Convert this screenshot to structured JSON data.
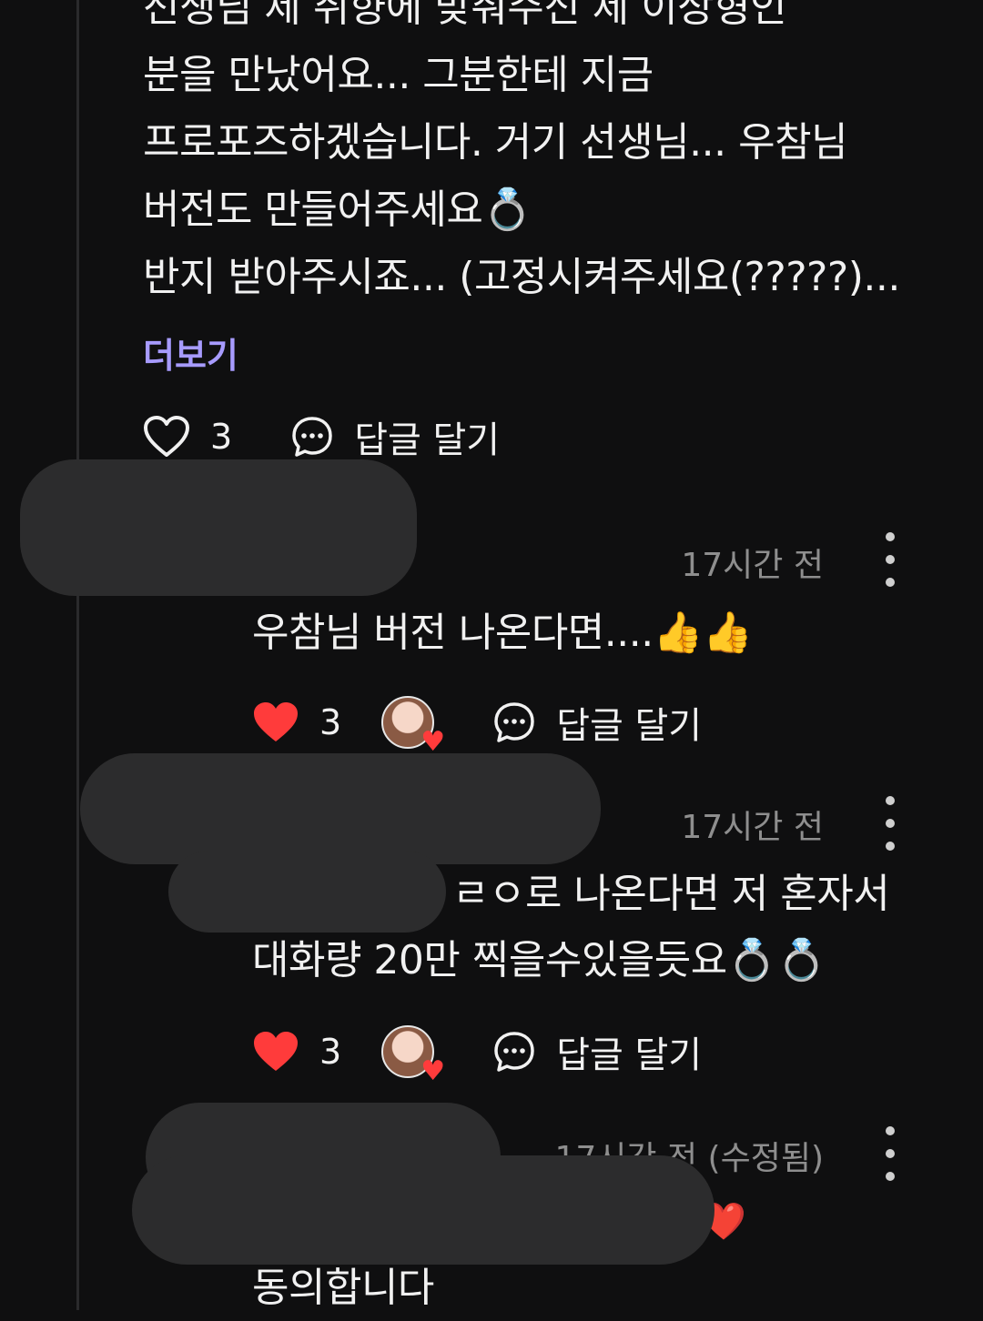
{
  "parent_comment": {
    "lines": [
      "선생님 제 취향에 맞춰주신 제 이상형인",
      "분을 만났어요... 그분한테 지금",
      "프로포즈하겠습니다. 거기 선생님... 우참님",
      "버전도 만들어주세요💍",
      "반지 받아주시죠... (고정시켜주세요(?????)..."
    ],
    "more_label": "더보기",
    "like_count": "3",
    "reply_label": "답글 달기"
  },
  "replies": [
    {
      "timestamp": "17시간 전",
      "text_lines": [
        "우참님 버전 나온다면....👍👍"
      ],
      "like_count": "3",
      "reply_label": "답글 달기",
      "liked": true,
      "creator_hearted": true
    },
    {
      "timestamp": "17시간 전",
      "text_lines": [
        "ㄹㅇ로 나온다면 저 혼자서",
        "대화량 20만 찍을수있을듯요💍💍"
      ],
      "like_count": "3",
      "reply_label": "답글 달기",
      "liked": true,
      "creator_hearted": true
    },
    {
      "timestamp": "17시간 전 (수정됨)",
      "text_lines": [
        "❤️",
        "동의합니다"
      ],
      "liked": false
    }
  ],
  "colors": {
    "background": "#0f0f10",
    "accent_more": "#a79bff",
    "like_red": "#ff3b3b",
    "timestamp_gray": "#8e8e8e"
  }
}
